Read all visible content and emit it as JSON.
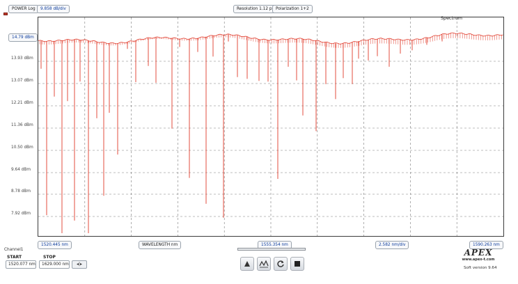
{
  "header": {
    "mode_label": "POWER Log",
    "scale_label": "9.858 dB/div",
    "resolution_label": "Resolution 1.12 pm",
    "polarization_label": "Polarization 1+2"
  },
  "plot": {
    "title": "Spectrum",
    "trace_color": "#e03a2a",
    "y_labels": [
      "14.79 dBm",
      "13.93 dBm",
      "13.07 dBm",
      "12.21 dBm",
      "11.36 dBm",
      "10.50 dBm",
      "9.64 dBm",
      "8.78 dBm",
      "7.92 dBm"
    ]
  },
  "axis": {
    "start_wavelength": "1520.445 nm",
    "x_label": "WAVELENGTH nm",
    "center_wavelength": "1555.354 nm",
    "span_per_div": "2.582 nm/div",
    "end_wavelength": "1590.263 nm"
  },
  "channel": {
    "name": "Channel1",
    "start_label": "START",
    "stop_label": "STOP",
    "start_value": "1520.077 nm",
    "stop_value": "1629.000 nm",
    "range_button": "◂|▸"
  },
  "toolbar": {
    "icons": [
      "marker-icon",
      "peak-search-icon",
      "refresh-icon",
      "stop-icon"
    ]
  },
  "brand": {
    "logo": "APEX",
    "url": "www.apex-t.com",
    "version": "Soft version 9.64"
  }
}
